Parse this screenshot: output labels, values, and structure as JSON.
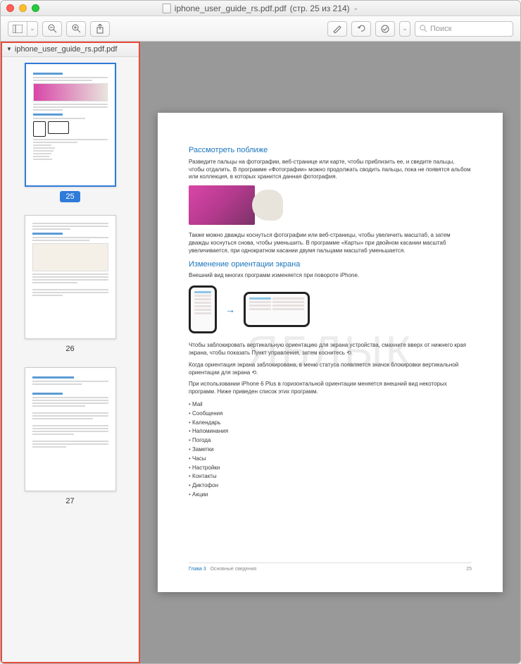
{
  "titlebar": {
    "filename": "iphone_user_guide_rs.pdf.pdf",
    "pagestatus": "(стр. 25 из 214)"
  },
  "toolbar": {
    "search_placeholder": "Поиск"
  },
  "sidebar": {
    "doctitle": "iphone_user_guide_rs.pdf.pdf",
    "thumbs": [
      {
        "label": "25",
        "selected": true
      },
      {
        "label": "26",
        "selected": false
      },
      {
        "label": "27",
        "selected": false
      }
    ]
  },
  "page": {
    "h1": "Рассмотреть поближе",
    "p1": "Разведите пальцы на фотографии, веб-странице или карте, чтобы приблизить ее, и сведите пальцы, чтобы отдалить. В программе «Фотографии» можно продолжать сводить пальцы, пока не появятся альбом или коллекция, в которых хранится данная фотография.",
    "p2": "Также можно дважды коснуться фотографии или веб-страницы, чтобы увеличить масштаб, а затем дважды коснуться снова, чтобы уменьшить. В программе «Карты» при двойном касании масштаб увеличивается, при однократном касании двумя пальцами масштаб уменьшается.",
    "h2": "Изменение ориентации экрана",
    "p3": "Внешний вид многих программ изменяется при повороте iPhone.",
    "p4": "Чтобы заблокировать вертикальную ориентацию для экрана устройства, смахните вверх от нижнего края экрана, чтобы показать Пункт управления, затем коснитесь ⟲.",
    "p5": "Когда ориентация экрана заблокирована, в меню статуса появляется значок блокировки вертикальной ориентации для экрана ⟲.",
    "p6": "При использовании iPhone 6 Plus в горизонтальной ориентации меняется внешний вид некоторых программ. Ниже приведен список этих программ.",
    "list": [
      "Mail",
      "Сообщения",
      "Календарь",
      "Напоминания",
      "Погода",
      "Заметки",
      "Часы",
      "Настройки",
      "Контакты",
      "Диктофон",
      "Акции"
    ],
    "footer_left": "Глава 3    Основные сведения",
    "footer_right": "25"
  },
  "watermark": "ЯБЛЫК"
}
